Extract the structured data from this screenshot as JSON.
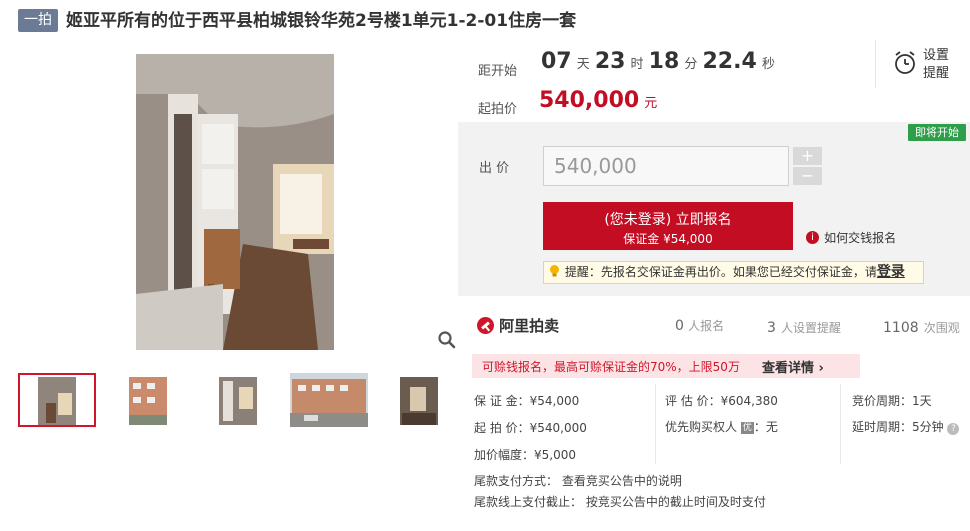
{
  "title": {
    "tag": "一拍",
    "text": "姬亚平所有的位于西平县柏城银铃华苑2号楼1单元1-2-01住房一套"
  },
  "countdown": {
    "label": "距开始",
    "days": "07",
    "days_unit": "天",
    "hours": "23",
    "hours_unit": "时",
    "minutes": "18",
    "minutes_unit": "分",
    "seconds": "22.4",
    "seconds_unit": "秒"
  },
  "start_price": {
    "label": "起拍价",
    "value": "540,000",
    "unit": "元"
  },
  "remind": {
    "line1": "设置",
    "line2": "提醒"
  },
  "status_badge": "即将开始",
  "bid": {
    "label": "出 价",
    "value": "540,000",
    "plus": "+",
    "minus": "−",
    "register_button_line1": "(您未登录) 立即报名",
    "register_button_line2": "保证金 ¥54,000",
    "how_to_pay": "如何交钱报名",
    "tip_prefix": "提醒：先报名交保证金再出价。如果您已经交付保证金，请",
    "tip_login": "登录"
  },
  "platform": {
    "name": "阿里拍卖",
    "applicants_count": "0",
    "applicants_label": "人报名",
    "reminders_count": "3",
    "reminders_label": "人设置提醒",
    "views_count": "1108",
    "views_label": "次围观"
  },
  "promo": {
    "text": "可赊钱报名，最高可赊保证金的70%，上限50万",
    "link": "查看详情"
  },
  "details": {
    "deposit": "保 证 金：¥54,000",
    "appraisal": "评 估 价：¥604,380",
    "bid_cycle": "竞价周期：1天",
    "start": "起 拍 价：¥540,000",
    "priority": "优先购买权人",
    "priority_value": "：无",
    "priority_mark": "优",
    "delay_cycle": "延时周期：5分钟",
    "increment": "加价幅度：¥5,000",
    "payment_method": "尾款支付方式：  查看竞买公告中的说明",
    "payment_deadline": "尾款线上支付截止：  按竞买公告中的截止时间及时支付"
  },
  "colors": {
    "brand_red": "#c30d23",
    "tag_blue": "#6c7b95",
    "badge_green": "#2e9e4a"
  },
  "icons": [
    "magnifier-icon",
    "alarm-clock-icon",
    "info-icon",
    "lightbulb-icon",
    "auction-hammer-icon",
    "chevron-right-icon",
    "question-icon"
  ]
}
